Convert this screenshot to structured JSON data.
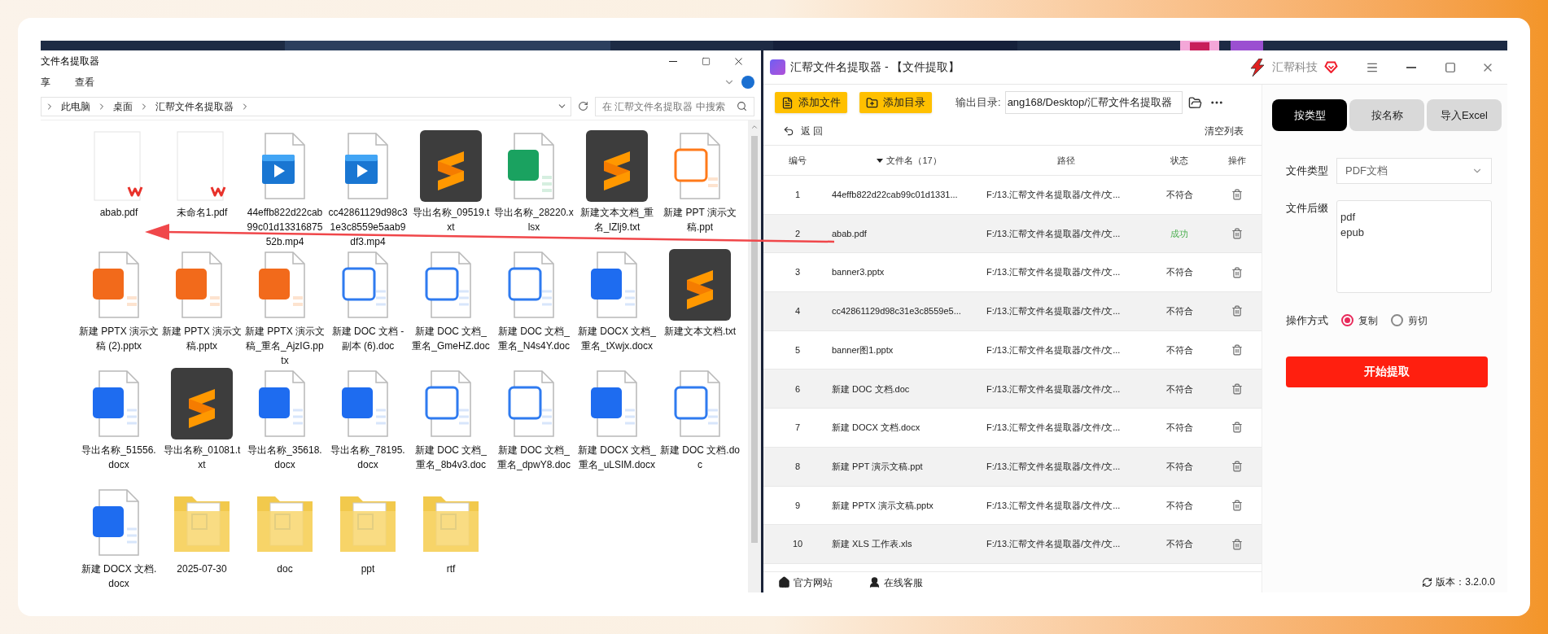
{
  "explorer": {
    "title": "文件名提取器",
    "menu": [
      "享",
      "查看"
    ],
    "breadcrumb": [
      "此电脑",
      "桌面",
      "汇帮文件名提取器"
    ],
    "search": {
      "placeholder": "在 汇帮文件名提取器 中搜索"
    },
    "files": [
      {
        "name": "abab.pdf",
        "kind": "pdf"
      },
      {
        "name": "未命名1.pdf",
        "kind": "pdf"
      },
      {
        "name": "44effb822d22cab99c01d1331687552b.mp4",
        "kind": "video"
      },
      {
        "name": "cc42861129d98c31e3c8559e5aab9df3.mp4",
        "kind": "video"
      },
      {
        "name": "导出名称_09519.txt",
        "kind": "txt"
      },
      {
        "name": "导出名称_28220.xlsx",
        "kind": "xlsx"
      },
      {
        "name": "新建文本文档_重名_lZlj9.txt",
        "kind": "txt"
      },
      {
        "name": "新建 PPT 演示文稿.ppt",
        "kind": "ppt"
      },
      {
        "name": "新建 PPTX 演示文稿 (2).pptx",
        "kind": "pptx"
      },
      {
        "name": "新建 PPTX 演示文稿.pptx",
        "kind": "pptx"
      },
      {
        "name": "新建 PPTX 演示文稿_重名_AjzIG.pptx",
        "kind": "pptx"
      },
      {
        "name": "新建 DOC 文档 - 副本 (6).doc",
        "kind": "doc"
      },
      {
        "name": "新建 DOC 文档_重名_GmeHZ.doc",
        "kind": "doc"
      },
      {
        "name": "新建 DOC 文档_重名_N4s4Y.doc",
        "kind": "doc"
      },
      {
        "name": "新建 DOCX 文档_重名_tXwjx.docx",
        "kind": "docx"
      },
      {
        "name": "新建文本文档.txt",
        "kind": "txt"
      },
      {
        "name": "导出名称_51556.docx",
        "kind": "docx"
      },
      {
        "name": "导出名称_01081.txt",
        "kind": "txt"
      },
      {
        "name": "导出名称_35618.docx",
        "kind": "docx"
      },
      {
        "name": "导出名称_78195.docx",
        "kind": "docx"
      },
      {
        "name": "新建 DOC 文档_重名_8b4v3.doc",
        "kind": "doc"
      },
      {
        "name": "新建 DOC 文档_重名_dpwY8.doc",
        "kind": "doc"
      },
      {
        "name": "新建 DOCX 文档_重名_uLSIM.docx",
        "kind": "docx"
      },
      {
        "name": "新建 DOC 文档.doc",
        "kind": "doc"
      },
      {
        "name": "新建 DOCX 文档.docx",
        "kind": "docx"
      },
      {
        "name": "2025-07-30",
        "kind": "folder"
      },
      {
        "name": "doc",
        "kind": "folder"
      },
      {
        "name": "ppt",
        "kind": "folder"
      },
      {
        "name": "rtf",
        "kind": "folder"
      }
    ]
  },
  "app": {
    "title": "汇帮文件名提取器 - 【文件提取】",
    "brand": "汇帮科技",
    "buttons": [
      "添加文件",
      "添加目录"
    ],
    "output": {
      "label": "输出目录:",
      "value": "ang168/Desktop/汇帮文件名提取器"
    },
    "back": "返 回",
    "clear": "清空列表",
    "columns": [
      "编号",
      "文件名（17）",
      "路径",
      "状态",
      "操作"
    ],
    "rows": [
      {
        "number": "1",
        "name": "44effb822d22cab99c01d1331...",
        "path": "F:/13.汇帮文件名提取器/文件/文...",
        "status": "不符合",
        "success": false
      },
      {
        "number": "2",
        "name": "abab.pdf",
        "path": "F:/13.汇帮文件名提取器/文件/文...",
        "status": "成功",
        "success": true
      },
      {
        "number": "3",
        "name": "banner3.pptx",
        "path": "F:/13.汇帮文件名提取器/文件/文...",
        "status": "不符合",
        "success": false
      },
      {
        "number": "4",
        "name": "cc42861129d98c31e3c8559e5...",
        "path": "F:/13.汇帮文件名提取器/文件/文...",
        "status": "不符合",
        "success": false
      },
      {
        "number": "5",
        "name": "banner图1.pptx",
        "path": "F:/13.汇帮文件名提取器/文件/文...",
        "status": "不符合",
        "success": false
      },
      {
        "number": "6",
        "name": "新建 DOC 文档.doc",
        "path": "F:/13.汇帮文件名提取器/文件/文...",
        "status": "不符合",
        "success": false
      },
      {
        "number": "7",
        "name": "新建 DOCX 文档.docx",
        "path": "F:/13.汇帮文件名提取器/文件/文...",
        "status": "不符合",
        "success": false
      },
      {
        "number": "8",
        "name": "新建 PPT 演示文稿.ppt",
        "path": "F:/13.汇帮文件名提取器/文件/文...",
        "status": "不符合",
        "success": false
      },
      {
        "number": "9",
        "name": "新建 PPTX 演示文稿.pptx",
        "path": "F:/13.汇帮文件名提取器/文件/文...",
        "status": "不符合",
        "success": false
      },
      {
        "number": "10",
        "name": "新建 XLS 工作表.xls",
        "path": "F:/13.汇帮文件名提取器/文件/文...",
        "status": "不符合",
        "success": false
      }
    ],
    "tabs": [
      {
        "label": "按类型",
        "selected": true
      },
      {
        "label": "按名称",
        "selected": false
      },
      {
        "label": "导入Excel",
        "selected": false
      }
    ],
    "file_type": {
      "label": "文件类型",
      "value": "PDF文档"
    },
    "suffix": {
      "label": "文件后缀",
      "value": "pdf\nepub"
    },
    "operation": {
      "label": "操作方式",
      "options": [
        {
          "label": "复制",
          "selected": true
        },
        {
          "label": "剪切",
          "selected": false
        }
      ]
    },
    "start": "开始提取",
    "footer": {
      "links": [
        "官方网站",
        "在线客服"
      ],
      "version": "版本：3.2.0.0"
    }
  }
}
